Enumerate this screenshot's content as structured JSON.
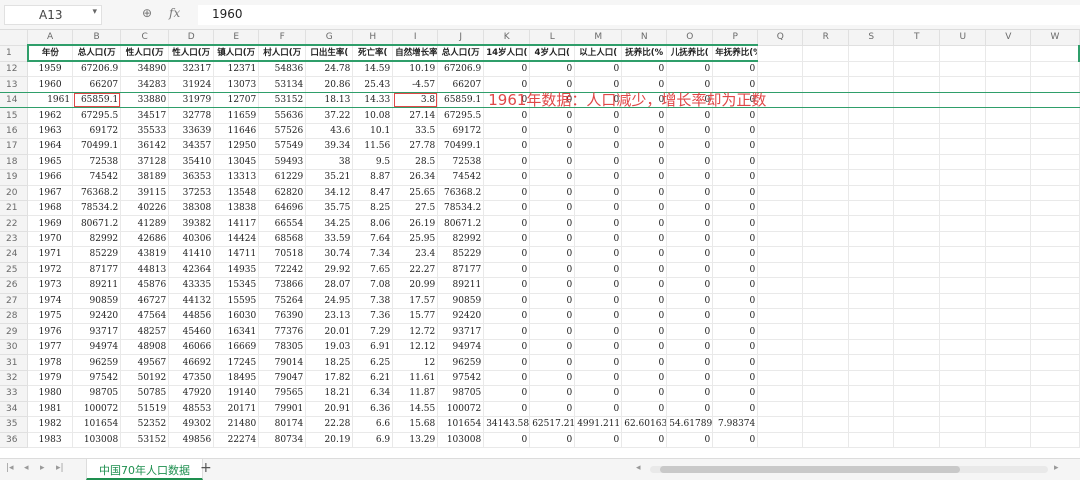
{
  "formula_bar": {
    "cell_ref": "A13",
    "zoom_icon": "zoom-icon",
    "fx_icon": "fx",
    "value": "1960"
  },
  "column_letters": [
    "A",
    "B",
    "C",
    "D",
    "E",
    "F",
    "G",
    "H",
    "I",
    "J",
    "K",
    "L",
    "M",
    "N",
    "O",
    "P",
    "Q",
    "R",
    "S",
    "T",
    "U",
    "V",
    "W"
  ],
  "header_row": {
    "row_number": "1",
    "cells": [
      "年份",
      "总人口(万",
      "性人口(万",
      "性人口(万",
      "镇人口(万",
      "村人口(万",
      "口出生率(",
      "死亡率(",
      "自然增长率",
      "总人口(万",
      "14岁人口(",
      "4岁人口(",
      "以上人口(",
      "抚养比(%",
      "儿抚养比(",
      "年抚养比(%)"
    ]
  },
  "annotation": "1961年数据：人口减少，增长率却为正数",
  "rows": [
    {
      "rn": "12",
      "year": "1959",
      "v": [
        "67206.9",
        "34890",
        "32317",
        "12371",
        "54836",
        "24.78",
        "14.59",
        "10.19",
        "67206.9",
        "0",
        "0",
        "0",
        "0",
        "0",
        "0"
      ]
    },
    {
      "rn": "13",
      "year": "1960",
      "v": [
        "66207",
        "34283",
        "31924",
        "13073",
        "53134",
        "20.86",
        "25.43",
        "-4.57",
        "66207",
        "0",
        "0",
        "0",
        "0",
        "0",
        "0"
      ]
    },
    {
      "rn": "14",
      "year": "1961",
      "v": [
        "65859.1",
        "33880",
        "31979",
        "12707",
        "53152",
        "18.13",
        "14.33",
        "3.8",
        "65859.1",
        "0",
        "0",
        "0",
        "0",
        "0",
        "0"
      ]
    },
    {
      "rn": "15",
      "year": "1962",
      "v": [
        "67295.5",
        "34517",
        "32778",
        "11659",
        "55636",
        "37.22",
        "10.08",
        "27.14",
        "67295.5",
        "0",
        "0",
        "0",
        "0",
        "0",
        "0"
      ]
    },
    {
      "rn": "16",
      "year": "1963",
      "v": [
        "69172",
        "35533",
        "33639",
        "11646",
        "57526",
        "43.6",
        "10.1",
        "33.5",
        "69172",
        "0",
        "0",
        "0",
        "0",
        "0",
        "0"
      ]
    },
    {
      "rn": "17",
      "year": "1964",
      "v": [
        "70499.1",
        "36142",
        "34357",
        "12950",
        "57549",
        "39.34",
        "11.56",
        "27.78",
        "70499.1",
        "0",
        "0",
        "0",
        "0",
        "0",
        "0"
      ]
    },
    {
      "rn": "18",
      "year": "1965",
      "v": [
        "72538",
        "37128",
        "35410",
        "13045",
        "59493",
        "38",
        "9.5",
        "28.5",
        "72538",
        "0",
        "0",
        "0",
        "0",
        "0",
        "0"
      ]
    },
    {
      "rn": "19",
      "year": "1966",
      "v": [
        "74542",
        "38189",
        "36353",
        "13313",
        "61229",
        "35.21",
        "8.87",
        "26.34",
        "74542",
        "0",
        "0",
        "0",
        "0",
        "0",
        "0"
      ]
    },
    {
      "rn": "20",
      "year": "1967",
      "v": [
        "76368.2",
        "39115",
        "37253",
        "13548",
        "62820",
        "34.12",
        "8.47",
        "25.65",
        "76368.2",
        "0",
        "0",
        "0",
        "0",
        "0",
        "0"
      ]
    },
    {
      "rn": "21",
      "year": "1968",
      "v": [
        "78534.2",
        "40226",
        "38308",
        "13838",
        "64696",
        "35.75",
        "8.25",
        "27.5",
        "78534.2",
        "0",
        "0",
        "0",
        "0",
        "0",
        "0"
      ]
    },
    {
      "rn": "22",
      "year": "1969",
      "v": [
        "80671.2",
        "41289",
        "39382",
        "14117",
        "66554",
        "34.25",
        "8.06",
        "26.19",
        "80671.2",
        "0",
        "0",
        "0",
        "0",
        "0",
        "0"
      ]
    },
    {
      "rn": "23",
      "year": "1970",
      "v": [
        "82992",
        "42686",
        "40306",
        "14424",
        "68568",
        "33.59",
        "7.64",
        "25.95",
        "82992",
        "0",
        "0",
        "0",
        "0",
        "0",
        "0"
      ]
    },
    {
      "rn": "24",
      "year": "1971",
      "v": [
        "85229",
        "43819",
        "41410",
        "14711",
        "70518",
        "30.74",
        "7.34",
        "23.4",
        "85229",
        "0",
        "0",
        "0",
        "0",
        "0",
        "0"
      ]
    },
    {
      "rn": "25",
      "year": "1972",
      "v": [
        "87177",
        "44813",
        "42364",
        "14935",
        "72242",
        "29.92",
        "7.65",
        "22.27",
        "87177",
        "0",
        "0",
        "0",
        "0",
        "0",
        "0"
      ]
    },
    {
      "rn": "26",
      "year": "1973",
      "v": [
        "89211",
        "45876",
        "43335",
        "15345",
        "73866",
        "28.07",
        "7.08",
        "20.99",
        "89211",
        "0",
        "0",
        "0",
        "0",
        "0",
        "0"
      ]
    },
    {
      "rn": "27",
      "year": "1974",
      "v": [
        "90859",
        "46727",
        "44132",
        "15595",
        "75264",
        "24.95",
        "7.38",
        "17.57",
        "90859",
        "0",
        "0",
        "0",
        "0",
        "0",
        "0"
      ]
    },
    {
      "rn": "28",
      "year": "1975",
      "v": [
        "92420",
        "47564",
        "44856",
        "16030",
        "76390",
        "23.13",
        "7.36",
        "15.77",
        "92420",
        "0",
        "0",
        "0",
        "0",
        "0",
        "0"
      ]
    },
    {
      "rn": "29",
      "year": "1976",
      "v": [
        "93717",
        "48257",
        "45460",
        "16341",
        "77376",
        "20.01",
        "7.29",
        "12.72",
        "93717",
        "0",
        "0",
        "0",
        "0",
        "0",
        "0"
      ]
    },
    {
      "rn": "30",
      "year": "1977",
      "v": [
        "94974",
        "48908",
        "46066",
        "16669",
        "78305",
        "19.03",
        "6.91",
        "12.12",
        "94974",
        "0",
        "0",
        "0",
        "0",
        "0",
        "0"
      ]
    },
    {
      "rn": "31",
      "year": "1978",
      "v": [
        "96259",
        "49567",
        "46692",
        "17245",
        "79014",
        "18.25",
        "6.25",
        "12",
        "96259",
        "0",
        "0",
        "0",
        "0",
        "0",
        "0"
      ]
    },
    {
      "rn": "32",
      "year": "1979",
      "v": [
        "97542",
        "50192",
        "47350",
        "18495",
        "79047",
        "17.82",
        "6.21",
        "11.61",
        "97542",
        "0",
        "0",
        "0",
        "0",
        "0",
        "0"
      ]
    },
    {
      "rn": "33",
      "year": "1980",
      "v": [
        "98705",
        "50785",
        "47920",
        "19140",
        "79565",
        "18.21",
        "6.34",
        "11.87",
        "98705",
        "0",
        "0",
        "0",
        "0",
        "0",
        "0"
      ]
    },
    {
      "rn": "34",
      "year": "1981",
      "v": [
        "100072",
        "51519",
        "48553",
        "20171",
        "79901",
        "20.91",
        "6.36",
        "14.55",
        "100072",
        "0",
        "0",
        "0",
        "0",
        "0",
        "0"
      ]
    },
    {
      "rn": "35",
      "year": "1982",
      "v": [
        "101654",
        "52352",
        "49302",
        "21480",
        "80174",
        "22.28",
        "6.6",
        "15.68",
        "101654",
        "34143.58",
        "62517.21",
        "4991.211",
        "62.60163",
        "54.61789",
        "7.98374"
      ]
    },
    {
      "rn": "36",
      "year": "1983",
      "v": [
        "103008",
        "53152",
        "49856",
        "22274",
        "80734",
        "20.19",
        "6.9",
        "13.29",
        "103008",
        "0",
        "0",
        "0",
        "0",
        "0",
        "0"
      ]
    }
  ],
  "sheet_tab": "中国70年人口数据",
  "add_sheet_label": "+"
}
